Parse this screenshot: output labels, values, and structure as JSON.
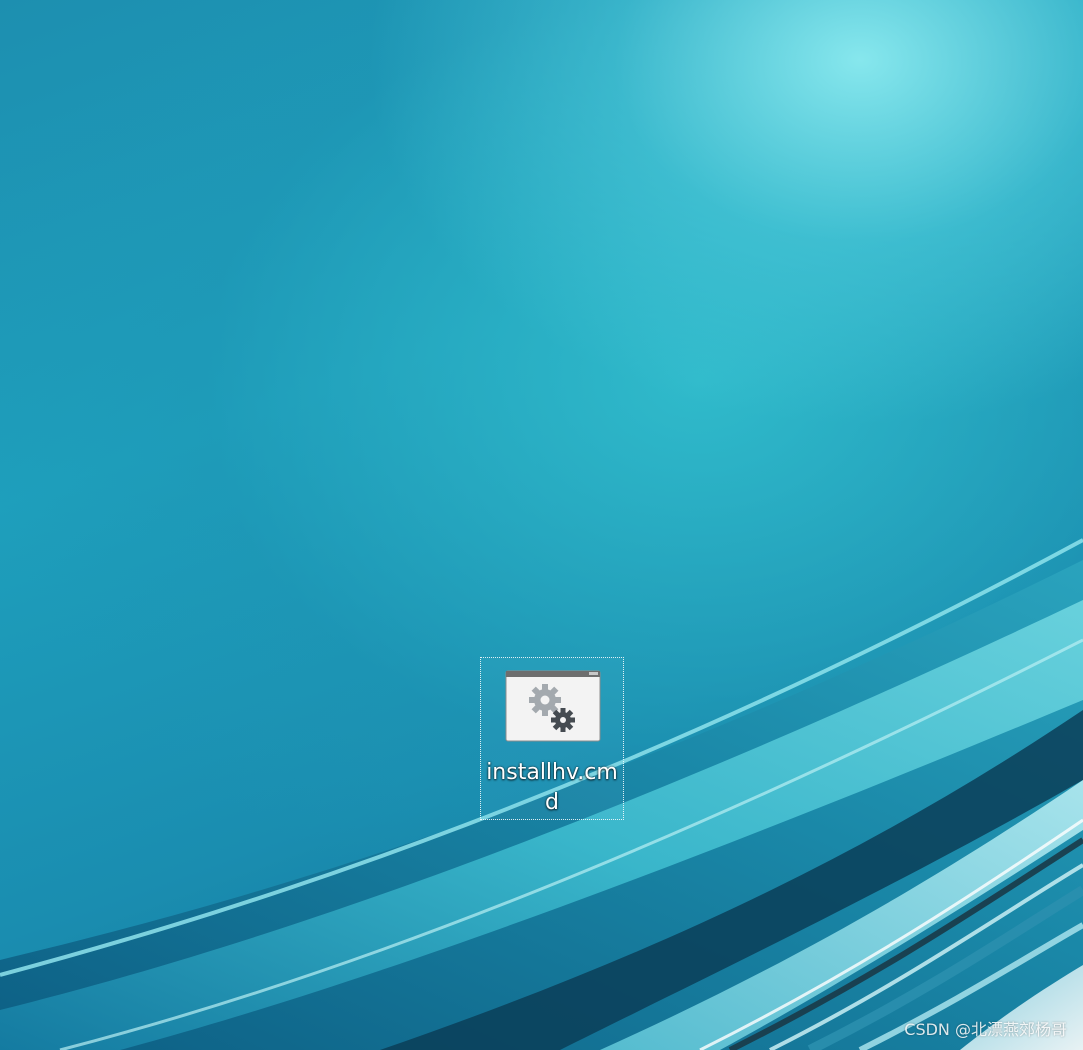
{
  "desktop": {
    "icons": [
      {
        "label": "installhv.cmd",
        "icon": "batch-file-gears-icon"
      }
    ]
  },
  "watermark": {
    "text": "CSDN @北漂燕郊杨哥"
  },
  "colors": {
    "wallpaper_light": "#8de8ee",
    "wallpaper_mid": "#1e9fbc",
    "wallpaper_dark": "#0f6d92",
    "icon_window": "#f2f2f2",
    "icon_gear_light": "#9aa0a6",
    "icon_gear_dark": "#444a50"
  }
}
